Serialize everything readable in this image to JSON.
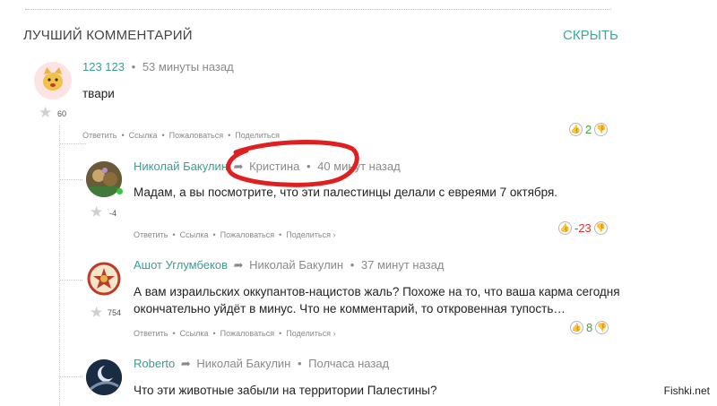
{
  "header": {
    "title": "ЛУЧШИЙ КОММЕНТАРИЙ",
    "hide_label": "СКРЫТЬ"
  },
  "actions": {
    "reply": "Ответить",
    "link": "Ссылка",
    "complain": "Пожаловаться",
    "share": "Поделиться",
    "share_arrow": "›",
    "dot": "•"
  },
  "comments": [
    {
      "author": "123 123",
      "time": "53 минуты назад",
      "text": "твари",
      "karma": "60",
      "score": "2",
      "avatar_icon": "cat-face-icon"
    },
    {
      "author": "Николай Бакулин",
      "reply_to": "Кристина",
      "time": "40 минут назад",
      "text": "Мадам, а вы посмотрите, что эти палестинцы делали с евреями 7 октября.",
      "karma": "-4",
      "score": "-23"
    },
    {
      "author": "Ашот Углумбеков",
      "reply_to": "Николай Бакулин",
      "time": "37 минут назад",
      "text_line1": "А вам израильских оккупантов-нацистов жаль? Похоже на то, что ваша карма сегодня",
      "text_line2": "окончательно уйдёт в минус. Что не комментарий, то откровенная тупость…",
      "karma": "754",
      "score": "8"
    },
    {
      "author": "Roberto",
      "reply_to": "Николай Бакулин",
      "time": "Полчаса назад",
      "text": "Что эти животные забыли на территории Палестины?"
    }
  ],
  "watermark": "Fishki.net",
  "colors": {
    "accent": "#3da89a",
    "positive": "#3ea33e",
    "negative": "#dd3333",
    "annotation": "#e02020"
  }
}
